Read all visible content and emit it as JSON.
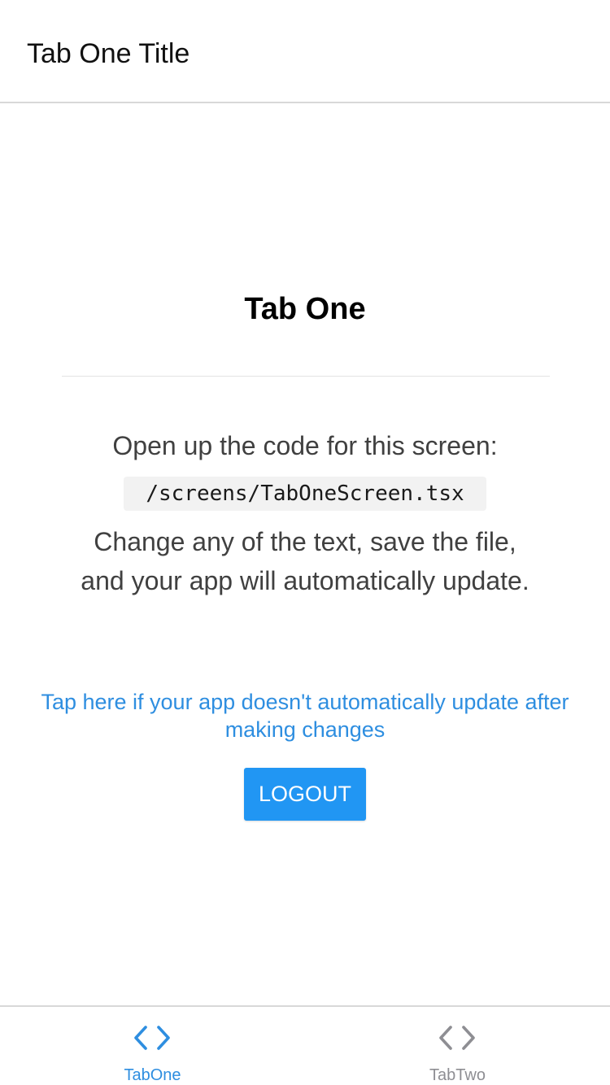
{
  "header": {
    "title": "Tab One Title"
  },
  "main": {
    "title": "Tab One",
    "intro": "Open up the code for this screen:",
    "code_path": "/screens/TabOneScreen.tsx",
    "body": "Change any of the text, save the file, and your app will automatically update.",
    "help_link": "Tap here if your app doesn't automatically update after making changes",
    "logout_label": "LOGOUT"
  },
  "tabs": [
    {
      "label": "TabOne",
      "icon": "code-icon",
      "active": true
    },
    {
      "label": "TabTwo",
      "icon": "code-icon",
      "active": false
    }
  ],
  "colors": {
    "accent": "#2e8ee0",
    "button": "#2196f3",
    "inactive_tab": "#8e8e93",
    "text": "#404040"
  }
}
